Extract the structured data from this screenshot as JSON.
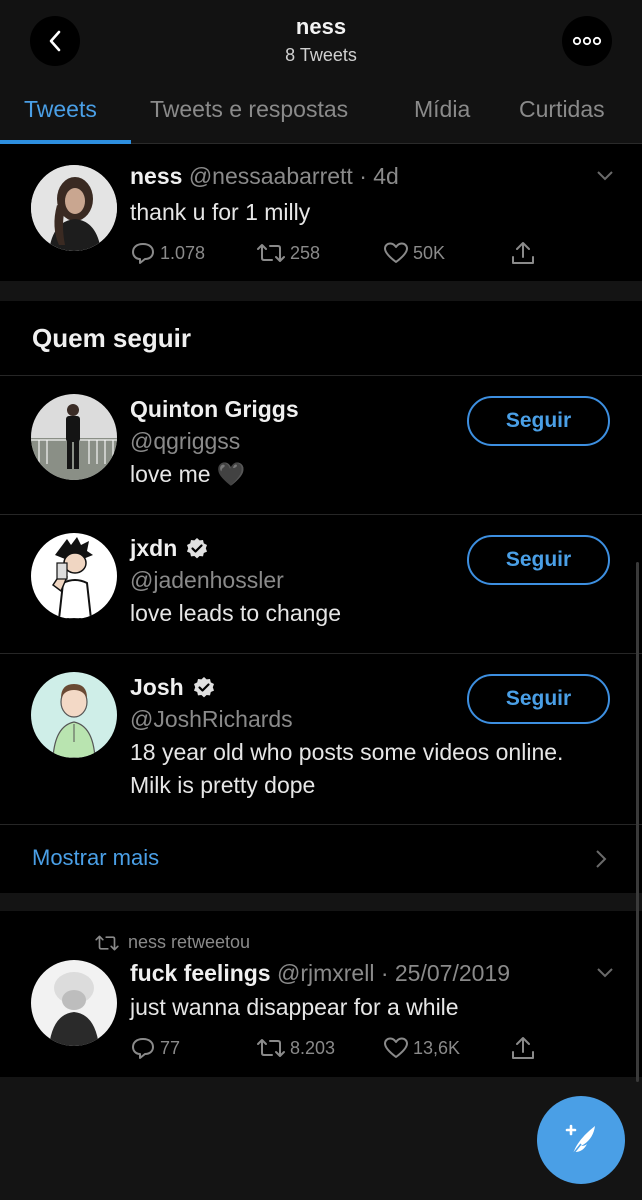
{
  "header": {
    "title": "ness",
    "subtitle": "8 Tweets"
  },
  "tabs": [
    {
      "label": "Tweets",
      "active": true
    },
    {
      "label": "Tweets e respostas",
      "active": false
    },
    {
      "label": "Mídia",
      "active": false
    },
    {
      "label": "Curtidas",
      "active": false
    }
  ],
  "tweet1": {
    "name": "ness",
    "handle": "@nessaabarrett",
    "time": "· 4d",
    "text": "thank u for 1 milly",
    "replies": "1.078",
    "retweets": "258",
    "likes": "50K"
  },
  "who_to_follow": {
    "title": "Quem seguir",
    "follow_label": "Seguir",
    "show_more": "Mostrar mais",
    "accounts": [
      {
        "name": "Quinton Griggs",
        "handle": "@qgriggss",
        "bio": "love me 🖤",
        "verified": false
      },
      {
        "name": "jxdn",
        "handle": "@jadenhossler",
        "bio": "love leads to change",
        "verified": true
      },
      {
        "name": "Josh",
        "handle": "@JoshRichards",
        "bio_line1": "18 year old who posts some videos online.",
        "bio_line2": "Milk is pretty dope",
        "verified": true
      }
    ]
  },
  "tweet2": {
    "retweet_context": "ness retweetou",
    "name": "fuck feelings",
    "handle": "@rjmxrell",
    "time": "· 25/07/2019",
    "text": "just wanna disappear for a while",
    "replies": "77",
    "retweets": "8.203",
    "likes": "13,6K"
  },
  "colors": {
    "background": "#000000",
    "surface": "#121212",
    "accent": "#4a9fe6",
    "muted_text": "#8a8a8a"
  },
  "icons": [
    "back-arrow-icon",
    "more-dots-icon",
    "reply-icon",
    "retweet-icon",
    "like-icon",
    "share-icon",
    "chevron-down-icon",
    "verified-icon",
    "chevron-right-icon",
    "compose-icon"
  ]
}
